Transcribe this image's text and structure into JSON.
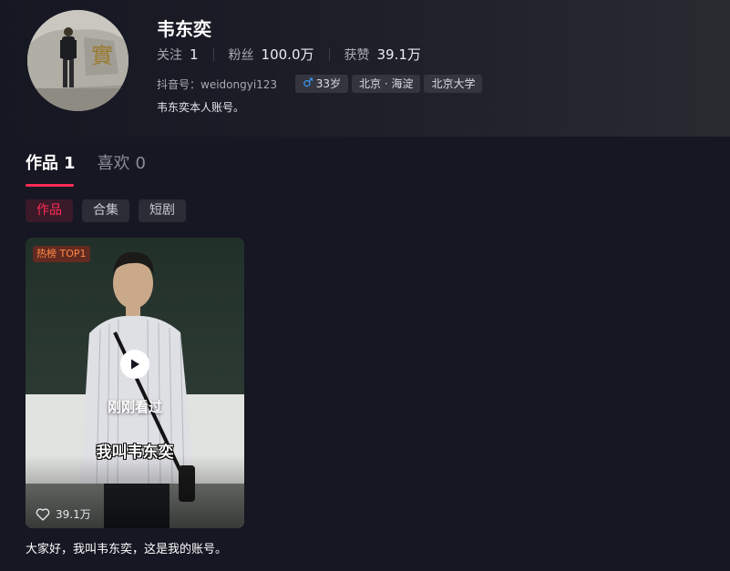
{
  "profile": {
    "nickname": "韦东奕",
    "stats": [
      {
        "label": "关注",
        "value": "1"
      },
      {
        "label": "粉丝",
        "value": "100.0万"
      },
      {
        "label": "获赞",
        "value": "39.1万"
      }
    ],
    "douyin_id": "抖音号：weidongyi123",
    "tags": {
      "age": "33岁",
      "location": "北京 · 海淀",
      "school": "北京大学"
    },
    "bio": "韦东奕本人账号。"
  },
  "tabs": [
    {
      "label": "作品",
      "count": "1"
    },
    {
      "label": "喜欢",
      "count": "0"
    }
  ],
  "filters": [
    "作品",
    "合集",
    "短剧"
  ],
  "video": {
    "badge": "热榜 TOP1",
    "recent_label": "刚刚看过",
    "burned_caption": "我叫韦东奕",
    "likes": "39.1万",
    "title": "大家好，我叫韦东奕，这是我的账号。"
  },
  "colors": {
    "accent": "#fe2c55",
    "background": "#161722",
    "male": "#3c9bff"
  },
  "icons": [
    "male-icon",
    "play-icon",
    "heart-icon"
  ]
}
